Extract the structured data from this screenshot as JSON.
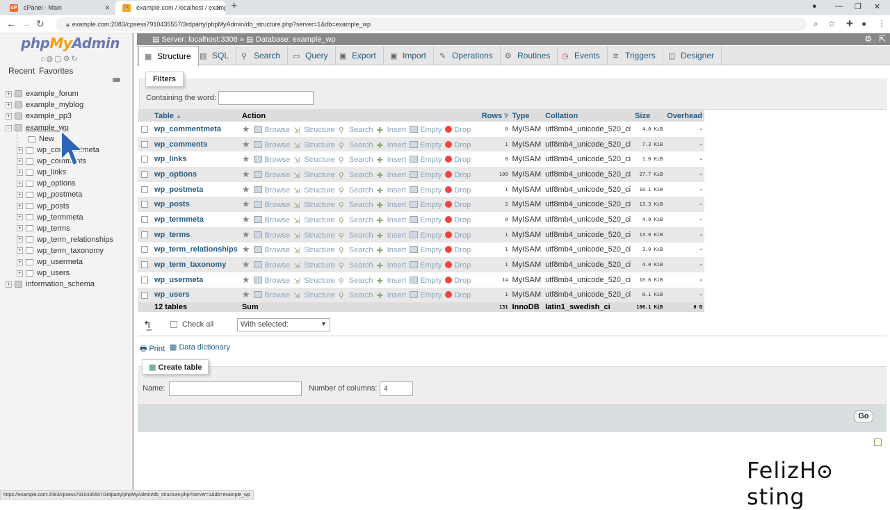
{
  "browser": {
    "tabs": [
      {
        "label": "cPanel - Main",
        "favicon": "cP"
      },
      {
        "label": "example.com / localhost / examp",
        "favicon": "pma"
      }
    ],
    "url": "example.com:2083/cpsess7910435557/3rdparty/phpMyAdmin/db_structure.php?server=1&db=example_wp",
    "status_url": "https://example.com:2083/cpsess7910435557/3rdparty/phpMyAdmin/db_structure.php?server=1&db=example_wp"
  },
  "nav": {
    "logo_php": "php",
    "logo_my": "My",
    "logo_admin": "Admin",
    "recent": "Recent",
    "favorites": "Favorites",
    "databases": [
      "example_forum",
      "example_myblog",
      "example_pp3",
      "example_wp"
    ],
    "new_label": "New",
    "tables": [
      "wp_commentmeta",
      "wp_comments",
      "wp_links",
      "wp_options",
      "wp_postmeta",
      "wp_posts",
      "wp_termmeta",
      "wp_terms",
      "wp_term_relationships",
      "wp_term_taxonomy",
      "wp_usermeta",
      "wp_users"
    ],
    "info_schema": "information_schema"
  },
  "breadcrumb": {
    "server": "Server: localhost:3306",
    "sep": "»",
    "database": "Database: example_wp"
  },
  "tabs": [
    "Structure",
    "SQL",
    "Search",
    "Query",
    "Export",
    "Import",
    "Operations",
    "Routines",
    "Events",
    "Triggers",
    "Designer"
  ],
  "filters": {
    "legend": "Filters",
    "label": "Containing the word:"
  },
  "table": {
    "headers": {
      "table": "Table",
      "action": "Action",
      "rows": "Rows",
      "type": "Type",
      "collation": "Collation",
      "size": "Size",
      "overhead": "Overhead"
    },
    "actions": [
      "Browse",
      "Structure",
      "Search",
      "Insert",
      "Empty",
      "Drop"
    ],
    "rows": [
      {
        "name": "wp_commentmeta",
        "rows": "0",
        "type": "MyISAM",
        "collation": "utf8mb4_unicode_520_ci",
        "size": "4.0 KiB",
        "overhead": "-"
      },
      {
        "name": "wp_comments",
        "rows": "1",
        "type": "MyISAM",
        "collation": "utf8mb4_unicode_520_ci",
        "size": "7.3 KiB",
        "overhead": "-"
      },
      {
        "name": "wp_links",
        "rows": "0",
        "type": "MyISAM",
        "collation": "utf8mb4_unicode_520_ci",
        "size": "1.0 KiB",
        "overhead": "-"
      },
      {
        "name": "wp_options",
        "rows": "109",
        "type": "MyISAM",
        "collation": "utf8mb4_unicode_520_ci",
        "size": "27.7 KiB",
        "overhead": "-"
      },
      {
        "name": "wp_postmeta",
        "rows": "1",
        "type": "MyISAM",
        "collation": "utf8mb4_unicode_520_ci",
        "size": "10.1 KiB",
        "overhead": "-"
      },
      {
        "name": "wp_posts",
        "rows": "2",
        "type": "MyISAM",
        "collation": "utf8mb4_unicode_520_ci",
        "size": "13.3 KiB",
        "overhead": "-"
      },
      {
        "name": "wp_termmeta",
        "rows": "0",
        "type": "MyISAM",
        "collation": "utf8mb4_unicode_520_ci",
        "size": "4.0 KiB",
        "overhead": "-"
      },
      {
        "name": "wp_terms",
        "rows": "1",
        "type": "MyISAM",
        "collation": "utf8mb4_unicode_520_ci",
        "size": "13.0 KiB",
        "overhead": "-"
      },
      {
        "name": "wp_term_relationships",
        "rows": "1",
        "type": "MyISAM",
        "collation": "utf8mb4_unicode_520_ci",
        "size": "3.0 KiB",
        "overhead": "-"
      },
      {
        "name": "wp_term_taxonomy",
        "rows": "1",
        "type": "MyISAM",
        "collation": "utf8mb4_unicode_520_ci",
        "size": "4.0 KiB",
        "overhead": "-"
      },
      {
        "name": "wp_usermeta",
        "rows": "14",
        "type": "MyISAM",
        "collation": "utf8mb4_unicode_520_ci",
        "size": "10.6 KiB",
        "overhead": "-"
      },
      {
        "name": "wp_users",
        "rows": "1",
        "type": "MyISAM",
        "collation": "utf8mb4_unicode_520_ci",
        "size": "8.1 KiB",
        "overhead": "-"
      }
    ],
    "summary": {
      "label": "12 tables",
      "sum": "Sum",
      "rows": "131",
      "type": "InnoDB",
      "collation": "latin1_swedish_ci",
      "size": "106.1 KiB",
      "overhead": "0 B"
    }
  },
  "bulk": {
    "check_all": "Check all",
    "with_selected": "With selected:"
  },
  "links": {
    "print": "Print",
    "data_dictionary": "Data dictionary"
  },
  "create_table": {
    "legend": "Create table",
    "name_label": "Name:",
    "columns_label": "Number of columns:",
    "columns_value": "4",
    "go": "Go"
  },
  "watermark": "FelizHosting",
  "colors": {
    "link": "#235a81",
    "header_bg": "#dddddd",
    "row_alt": "#e8e8e8",
    "breadcrumb_bg": "#888888",
    "cursor": "#2d66b8"
  }
}
